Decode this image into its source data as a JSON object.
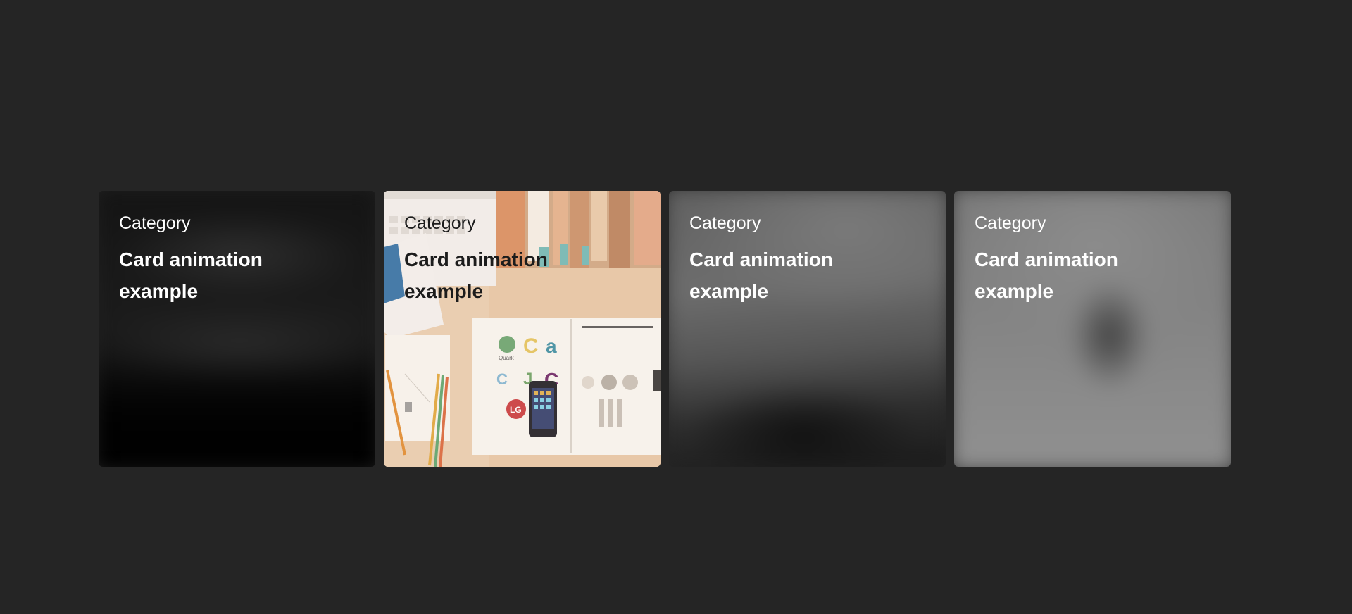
{
  "cards": [
    {
      "category": "Category",
      "title": "Card animation example",
      "state": "blurred"
    },
    {
      "category": "Category",
      "title": "Card animation example",
      "state": "focused"
    },
    {
      "category": "Category",
      "title": "Card animation example",
      "state": "blurred"
    },
    {
      "category": "Category",
      "title": "Card animation example",
      "state": "blurred"
    }
  ],
  "colors": {
    "page_background": "#252525",
    "text_light": "#ffffff",
    "text_dark": "#1c1c1c"
  },
  "photo": {
    "logos": [
      "Quark",
      "C",
      "a",
      "C",
      "J",
      "C",
      "LG"
    ]
  }
}
